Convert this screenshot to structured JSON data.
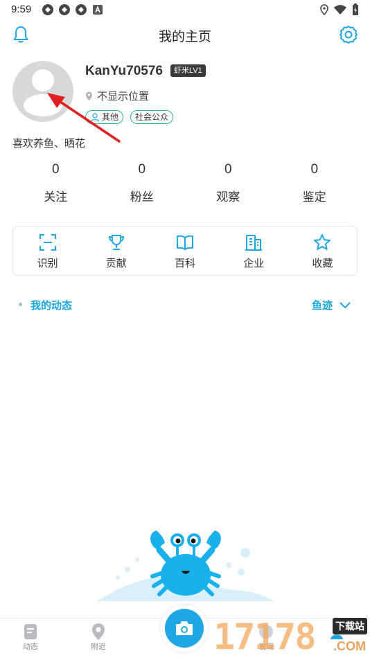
{
  "status_bar": {
    "time": "9:59"
  },
  "header": {
    "title": "我的主页",
    "left_icon": "bell-icon",
    "right_icon": "gear-icon"
  },
  "profile": {
    "username": "KanYu70576",
    "level": "虾米LV1",
    "location": "不显示位置",
    "tags": [
      "其他",
      "社会公众"
    ],
    "bio": "喜欢养鱼、晒花"
  },
  "stats": [
    {
      "value": "0",
      "label": "关注"
    },
    {
      "value": "0",
      "label": "粉丝"
    },
    {
      "value": "0",
      "label": "观察"
    },
    {
      "value": "0",
      "label": "鉴定"
    }
  ],
  "features": [
    {
      "label": "识别",
      "icon": "scan-icon"
    },
    {
      "label": "贡献",
      "icon": "trophy-icon"
    },
    {
      "label": "百科",
      "icon": "book-icon"
    },
    {
      "label": "企业",
      "icon": "building-icon"
    },
    {
      "label": "收藏",
      "icon": "star-icon"
    }
  ],
  "posts": {
    "title": "我的动态",
    "filter": "鱼迹"
  },
  "bottom_nav": {
    "feed": "动态",
    "nearby": "附近",
    "discover": "发现"
  },
  "watermark": {
    "digits": "17178",
    "site": "下载站",
    "domain": ".COM"
  },
  "colors": {
    "accent": "#1ea7e4",
    "tag_border": "#2bb39a",
    "annotation": "#e02020"
  }
}
